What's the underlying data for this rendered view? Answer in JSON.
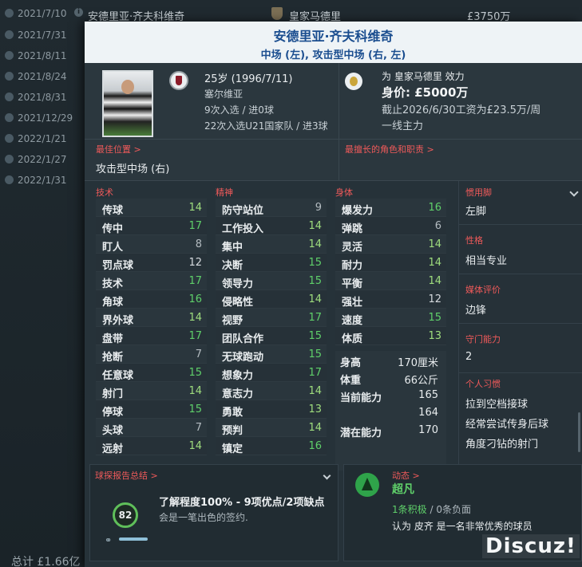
{
  "background_list": {
    "rows": [
      {
        "date": "2021/7/10",
        "name": "安德里亚·齐夫科维奇",
        "club": "皇家马德里",
        "fee": "£3750万"
      },
      {
        "date": "2021/7/31"
      },
      {
        "date": "2021/8/11"
      },
      {
        "date": "2021/8/24"
      },
      {
        "date": "2021/8/31"
      },
      {
        "date": "2021/12/29"
      },
      {
        "date": "2022/1/21"
      },
      {
        "date": "2022/1/27"
      },
      {
        "date": "2022/1/31"
      }
    ],
    "total": "总计 £1.66亿"
  },
  "header": {
    "name": "安德里亚·齐夫科维奇",
    "positions": "中场 (左), 攻击型中场 (右, 左)"
  },
  "info": {
    "age": "25岁 (1996/7/11)",
    "nationality": "塞尔维亚",
    "caps": "9次入选 / 进0球",
    "u21_caps": "22次入选U21国家队 / 进3球",
    "club_line": "为 皇家马德里 效力",
    "value": "身价: £5000万",
    "contract": "截止2026/6/30工资为£23.5万/周",
    "squad_status": "一线主力"
  },
  "positions": {
    "best_label": "最佳位置 >",
    "best_value": "攻击型中场 (右)",
    "role_label": "最擅长的角色和职责 >"
  },
  "attributes": {
    "technical_label": "技术",
    "mental_label": "精神",
    "physical_label": "身体",
    "technical": [
      {
        "name": "传球",
        "value": "14"
      },
      {
        "name": "传中",
        "value": "17"
      },
      {
        "name": "盯人",
        "value": "8"
      },
      {
        "name": "罚点球",
        "value": "12"
      },
      {
        "name": "技术",
        "value": "17"
      },
      {
        "name": "角球",
        "value": "16"
      },
      {
        "name": "界外球",
        "value": "14"
      },
      {
        "name": "盘带",
        "value": "17"
      },
      {
        "name": "抢断",
        "value": "7"
      },
      {
        "name": "任意球",
        "value": "15"
      },
      {
        "name": "射门",
        "value": "14"
      },
      {
        "name": "停球",
        "value": "15"
      },
      {
        "name": "头球",
        "value": "7"
      },
      {
        "name": "远射",
        "value": "14"
      }
    ],
    "mental": [
      {
        "name": "防守站位",
        "value": "9"
      },
      {
        "name": "工作投入",
        "value": "14"
      },
      {
        "name": "集中",
        "value": "14"
      },
      {
        "name": "决断",
        "value": "15"
      },
      {
        "name": "领导力",
        "value": "15"
      },
      {
        "name": "侵略性",
        "value": "14"
      },
      {
        "name": "视野",
        "value": "17"
      },
      {
        "name": "团队合作",
        "value": "15"
      },
      {
        "name": "无球跑动",
        "value": "15"
      },
      {
        "name": "想象力",
        "value": "17"
      },
      {
        "name": "意志力",
        "value": "14"
      },
      {
        "name": "勇敢",
        "value": "13"
      },
      {
        "name": "预判",
        "value": "14"
      },
      {
        "name": "镇定",
        "value": "16"
      }
    ],
    "physical": [
      {
        "name": "爆发力",
        "value": "16"
      },
      {
        "name": "弹跳",
        "value": "6"
      },
      {
        "name": "灵活",
        "value": "14"
      },
      {
        "name": "耐力",
        "value": "14"
      },
      {
        "name": "平衡",
        "value": "14"
      },
      {
        "name": "强壮",
        "value": "12"
      },
      {
        "name": "速度",
        "value": "15"
      },
      {
        "name": "体质",
        "value": "13"
      }
    ],
    "physical_extra": {
      "height_label": "身高",
      "height_value": "170厘米",
      "weight_label": "体重",
      "weight_value": "66公斤",
      "ca_label": "当前能力",
      "ca_value": "165",
      "ca_value2": "164",
      "pa_label": "潜在能力",
      "pa_value": "170"
    }
  },
  "side": {
    "foot_label": "惯用脚",
    "foot_value": "左脚",
    "personality_label": "性格",
    "personality_value": "相当专业",
    "media_label": "媒体评价",
    "media_value": "边锋",
    "gk_label": "守门能力",
    "gk_value": "2",
    "habits_label": "个人习惯",
    "habits": [
      "拉到空档接球",
      "经常尝试传身后球",
      "角度刁钻的射门"
    ]
  },
  "scout": {
    "label": "球探报告总结 >",
    "rating": "82",
    "summary": "了解程度100% - 9项优点/2项缺点",
    "desc": "会是一笔出色的签约."
  },
  "dynamics": {
    "label": "动态 >",
    "status": "超凡",
    "positive": "1条积极",
    "separator": " / ",
    "negative": "0条负面",
    "comment": "认为 皮齐 是一名非常优秀的球员"
  },
  "watermark": "Discuz!",
  "colors": {
    "accent_red": "#f05a5a",
    "header_blue": "#1a4d8f",
    "good_green": "#5fd06a"
  }
}
